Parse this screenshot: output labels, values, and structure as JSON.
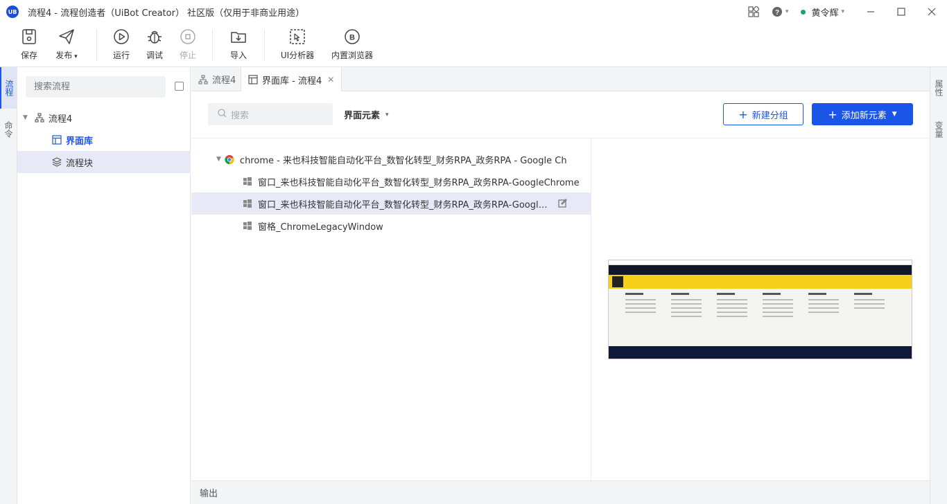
{
  "app": {
    "logo_text": "UB",
    "title": "流程4 - 流程创造者（UiBot Creator） 社区版（仅用于非商业用途）"
  },
  "titlebar": {
    "user_name": "黄令辉",
    "icons": [
      "apps-grid-icon",
      "help-icon",
      "minimize-icon",
      "maximize-icon",
      "close-icon"
    ]
  },
  "toolbar": {
    "save": "保存",
    "publish": "发布",
    "run": "运行",
    "debug": "调试",
    "stop": "停止",
    "import": "导入",
    "ui_analyzer": "UI分析器",
    "builtin_browser": "内置浏览器"
  },
  "left_rail": {
    "items": [
      "流程",
      "命令"
    ]
  },
  "right_rail": {
    "items": [
      "属性",
      "变量"
    ]
  },
  "left_panel": {
    "search_placeholder": "搜索流程",
    "tree": {
      "root": "流程4",
      "ui_library": "界面库",
      "flow_block": "流程块"
    }
  },
  "tabs": [
    {
      "label": "流程4",
      "icon": "flow-icon"
    },
    {
      "label": "界面库 - 流程4",
      "icon": "library-icon",
      "active": true
    }
  ],
  "main": {
    "search_placeholder": "搜索",
    "filter_label": "界面元素",
    "new_group_button": "新建分组",
    "add_element_button": "添加新元素",
    "elements": [
      {
        "label": "chrome - 来也科技智能自动化平台_数智化转型_财务RPA_政务RPA - Google Ch",
        "icon": "chrome-icon",
        "level": 0
      },
      {
        "label": "窗口_来也科技智能自动化平台_数智化转型_财务RPA_政务RPA-GoogleChrome",
        "icon": "window-icon",
        "level": 1
      },
      {
        "label": "窗口_来也科技智能自动化平台_数智化转型_财务RPA_政务RPA-GoogleChr...",
        "icon": "window-icon",
        "level": 1,
        "selected": true
      },
      {
        "label": "窗格_ChromeLegacyWindow",
        "icon": "window-icon",
        "level": 1
      }
    ]
  },
  "output": {
    "label": "输出"
  },
  "colors": {
    "accent": "#1a55e8",
    "selected_row": "#e7eaf6",
    "panel_bg": "#f3f4f6"
  }
}
